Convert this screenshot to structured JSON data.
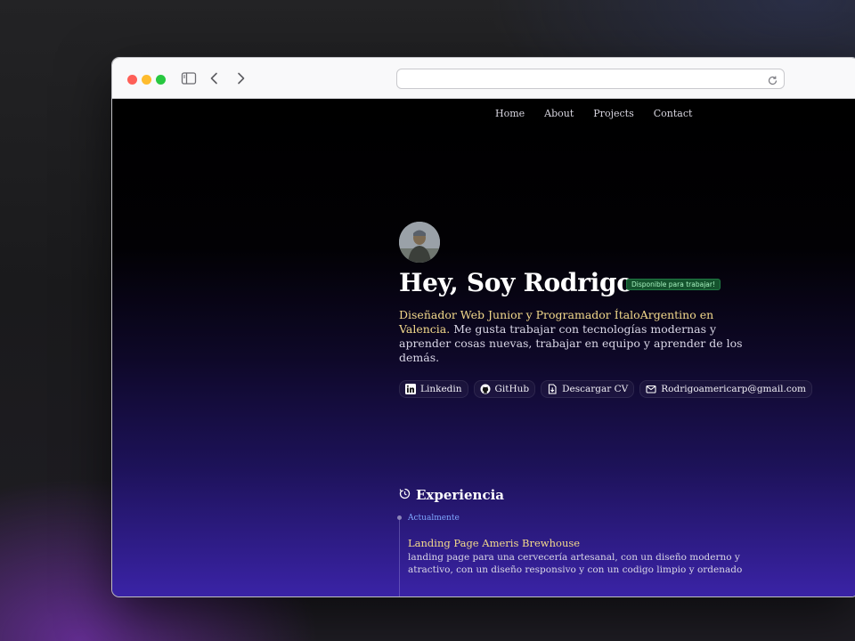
{
  "browser": {
    "controls": [
      "close",
      "minimize",
      "maximize"
    ],
    "icons": [
      "sidebar-icon",
      "back-icon",
      "forward-icon",
      "reload-icon"
    ]
  },
  "nav": {
    "items": [
      {
        "label": "Home"
      },
      {
        "label": "About"
      },
      {
        "label": "Projects"
      },
      {
        "label": "Contact"
      }
    ]
  },
  "hero": {
    "title": "Hey, Soy Rodrigo",
    "badge": "Disponible para trabajar!",
    "intro_highlight": "Diseñador Web Junior y Programador ÍtaloArgentino en Valencia.",
    "intro_rest": "Me gusta trabajar con tecnologías modernas y aprender cosas nuevas, trabajar en equipo y aprender de los demás."
  },
  "links": [
    {
      "label": "Linkedin",
      "icon": "linkedin-icon"
    },
    {
      "label": "GitHub",
      "icon": "github-icon"
    },
    {
      "label": "Descargar CV",
      "icon": "download-icon"
    },
    {
      "label": "Rodrigoamericarp@gmail.com",
      "icon": "mail-icon"
    }
  ],
  "experience": {
    "title": "Experiencia",
    "items": [
      {
        "date": "Actualmente",
        "job": "Landing Page Ameris Brewhouse",
        "description": "landing page para una cervecería artesanal, con un diseño moderno y atractivo, con un diseño responsivo y con un codigo limpio y ordenado"
      }
    ]
  },
  "colors": {
    "accent_gold": "#f3d98b",
    "badge_green": "#14532d",
    "date_blue": "#7fa8ff",
    "gradient_bottom": "#3a23a6"
  }
}
